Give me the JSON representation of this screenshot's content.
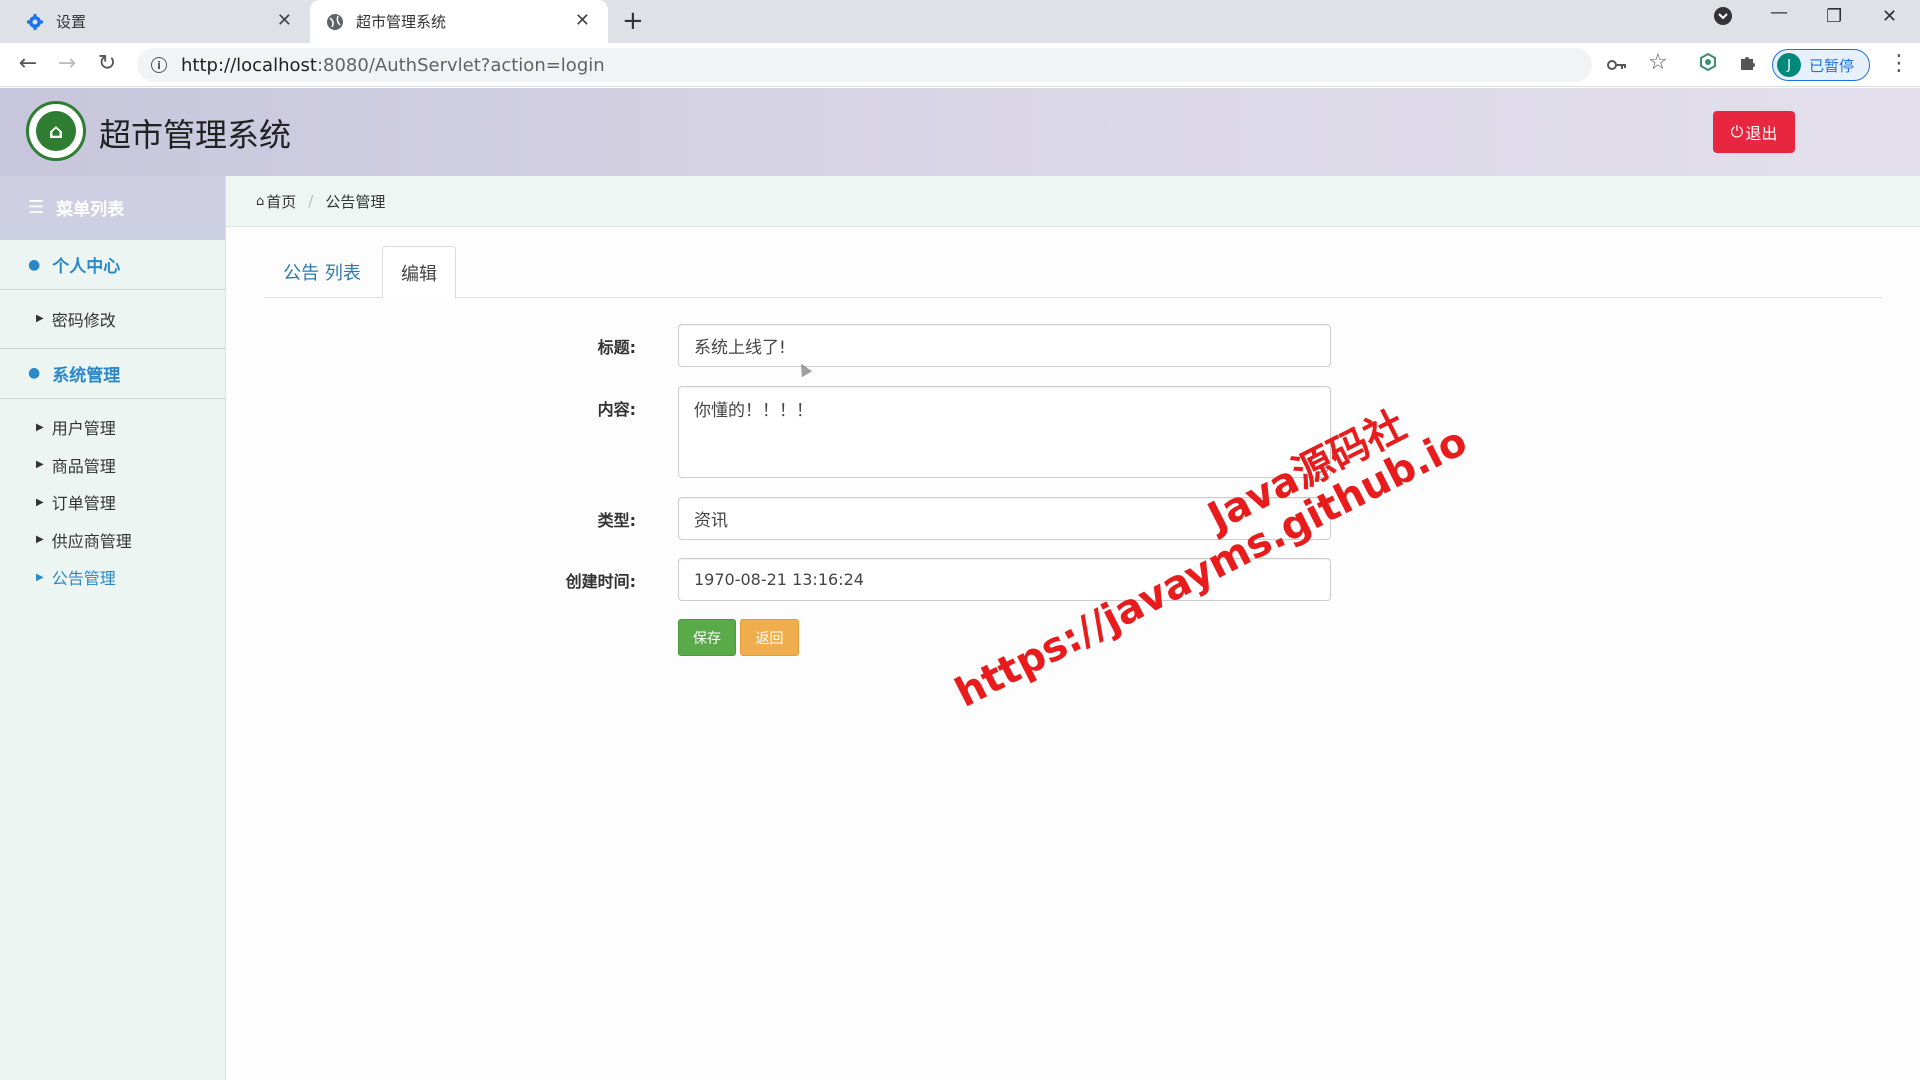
{
  "browser": {
    "tabs": [
      {
        "label": "设置",
        "icon": "gear-icon"
      },
      {
        "label": "超市管理系统",
        "icon": "globe-icon"
      }
    ],
    "url_host": "http://localhost",
    "url_rest": ":8080/AuthServlet?action=login",
    "profile_initial": "J",
    "profile_label": "已暂停"
  },
  "header": {
    "title": "超市管理系统",
    "logout_label": "退出"
  },
  "sidebar": {
    "menu_title": "菜单列表",
    "groups": [
      {
        "title": "个人中心",
        "items": [
          "密码修改"
        ]
      },
      {
        "title": "系统管理",
        "items": [
          "用户管理",
          "商品管理",
          "订单管理",
          "供应商管理",
          "公告管理"
        ]
      }
    ],
    "active_item": "公告管理"
  },
  "breadcrumb": {
    "home": "首页",
    "current": "公告管理"
  },
  "tabs": {
    "list": "公告 列表",
    "edit": "编辑"
  },
  "form": {
    "title_label": "标题:",
    "title_value": "系统上线了!",
    "content_label": "内容:",
    "content_value": "你懂的！！！！",
    "type_label": "类型:",
    "type_value": "资讯",
    "created_label": "创建时间:",
    "created_value": "1970-08-21 13:16:24",
    "save_label": "保存",
    "back_label": "返回"
  },
  "watermark": {
    "line1": "Java源码社",
    "line2": "https://javayms.github.io"
  },
  "colors": {
    "accent": "#2a88c8",
    "logout": "#e8263f",
    "save": "#5aaa4a",
    "back": "#f0ad4e",
    "watermark": "#e81c1c"
  }
}
